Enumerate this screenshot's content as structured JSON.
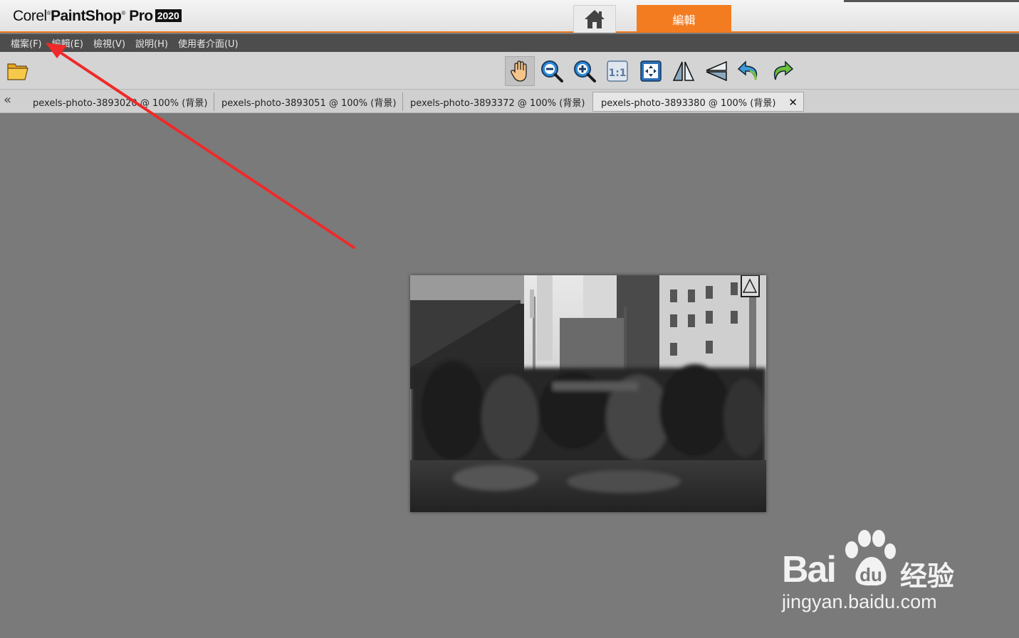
{
  "app": {
    "brand_corel": "Corel",
    "brand_paintshop": "PaintShop",
    "brand_pro": "Pro",
    "brand_year": "2020",
    "accent": "#f47c20"
  },
  "workspace_tabs": {
    "home_icon": "home-icon",
    "edit_label": "編輯"
  },
  "menu": [
    "檔案(F)",
    "編輯(E)",
    "檢視(V)",
    "說明(H)",
    "使用者介面(U)"
  ],
  "toolbar": {
    "open_icon": "folder-open-icon",
    "tools": [
      "pan-hand-icon",
      "zoom-out-icon",
      "zoom-in-icon",
      "actual-size-icon",
      "fit-to-window-icon",
      "flip-icon",
      "mirror-icon",
      "undo-icon",
      "redo-icon"
    ]
  },
  "doc_tabs": {
    "scroll_glyph": "«",
    "tabs": [
      {
        "label": "pexels-photo-3893020 @ 100% (背景)"
      },
      {
        "label": "pexels-photo-3893051 @ 100% (背景)"
      },
      {
        "label": "pexels-photo-3893372 @ 100% (背景)"
      },
      {
        "label": "pexels-photo-3893380 @ 100% (背景)",
        "active": true
      }
    ],
    "close_glyph": "✕"
  },
  "watermark": {
    "bai": "Bai",
    "du": "du",
    "exp": "经验",
    "url": "jingyan.baidu.com"
  }
}
